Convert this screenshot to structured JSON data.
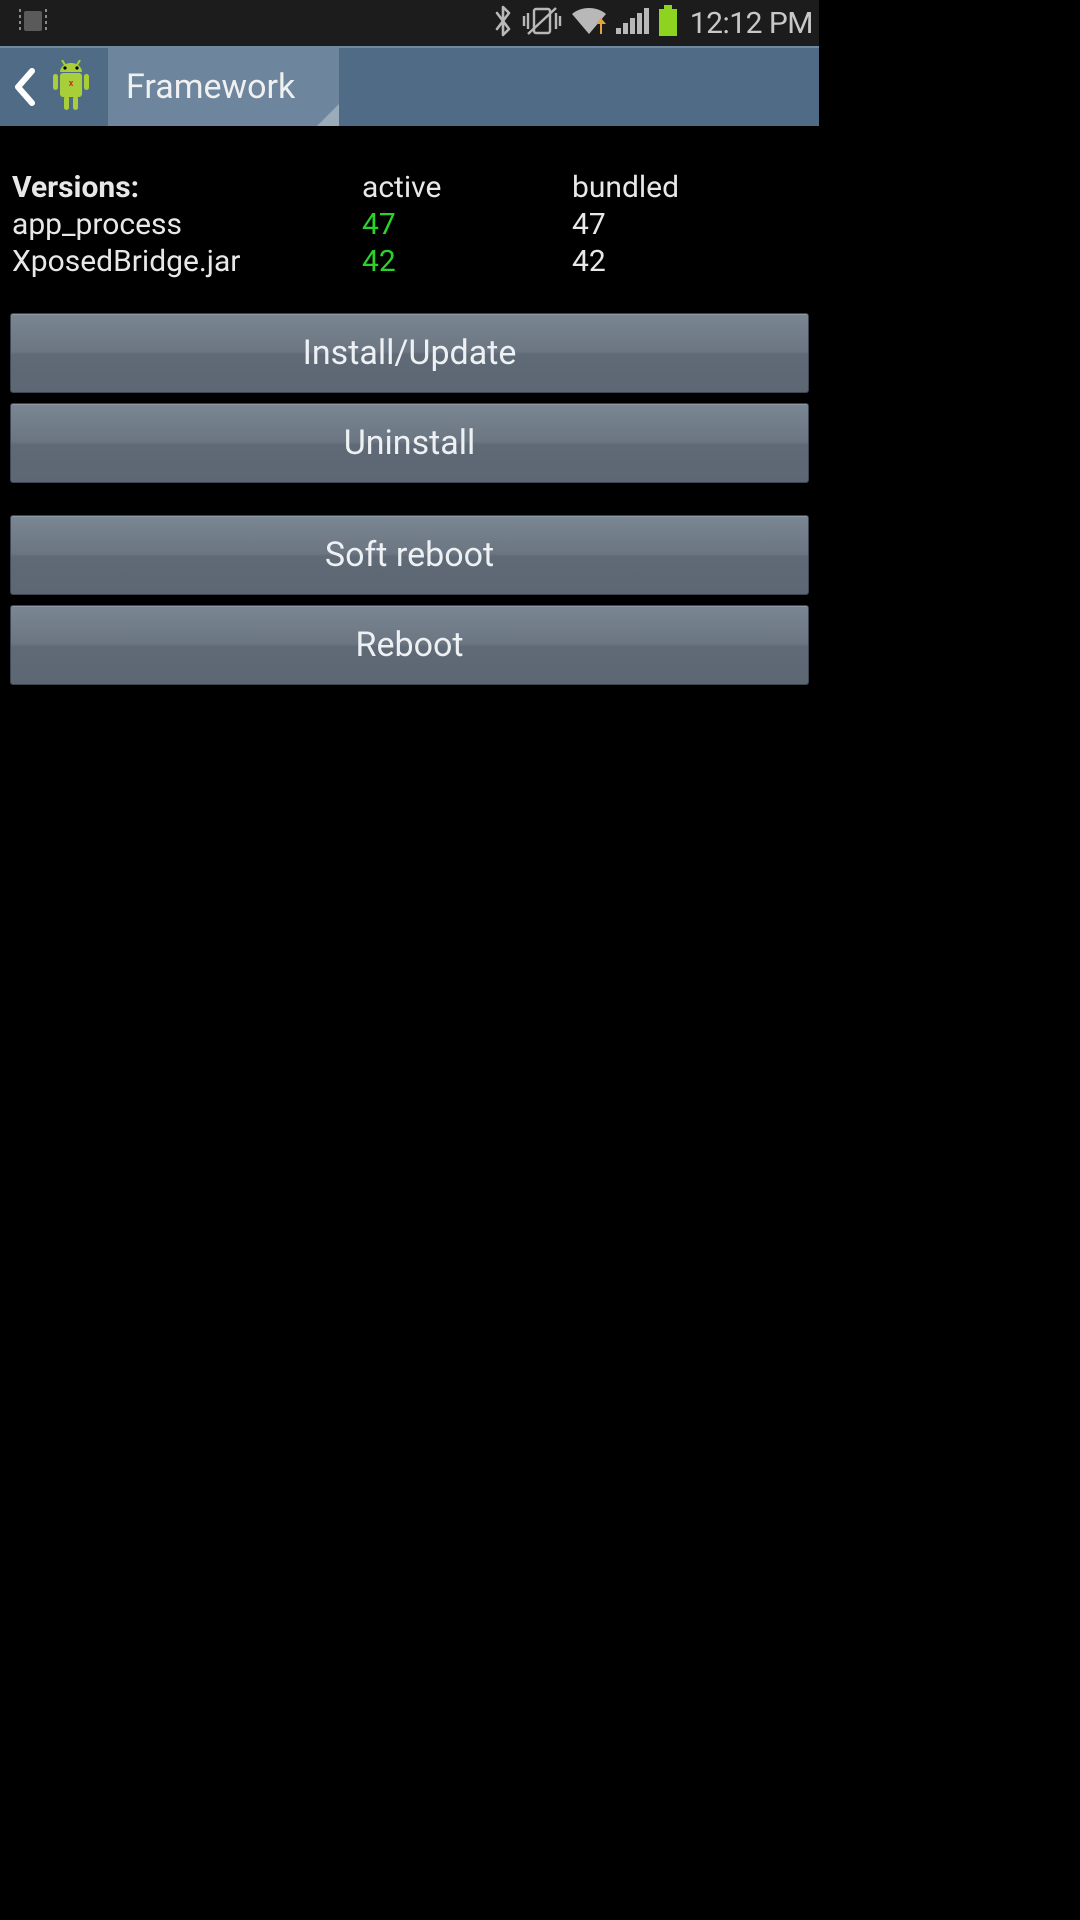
{
  "status": {
    "time": "12:12 PM"
  },
  "actionbar": {
    "title": "Framework"
  },
  "versions": {
    "header": "Versions:",
    "col_active": "active",
    "col_bundled": "bundled",
    "rows": [
      {
        "name": "app_process",
        "active": "47",
        "bundled": "47"
      },
      {
        "name": "XposedBridge.jar",
        "active": "42",
        "bundled": "42"
      }
    ]
  },
  "buttons": {
    "install": "Install/Update",
    "uninstall": "Uninstall",
    "softreboot": "Soft reboot",
    "reboot": "Reboot"
  },
  "colors": {
    "active_value": "#29d329",
    "actionbar_bg": "#4f6b85",
    "tab_bg": "#6d869e"
  }
}
